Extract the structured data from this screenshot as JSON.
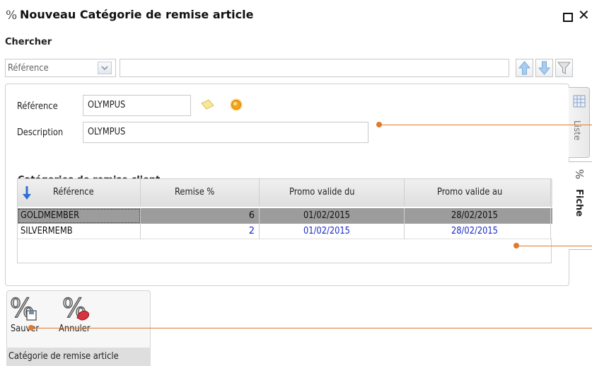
{
  "window": {
    "title_icon": "%",
    "title": "Nouveau Catégorie de remise article",
    "maximize_icon": "maximize-icon",
    "close_icon": "close-icon"
  },
  "search": {
    "label": "Chercher",
    "field_value": "Référence",
    "query": ""
  },
  "form": {
    "reference_label": "Référence",
    "reference_value": "OLYMPUS",
    "description_label": "Description",
    "description_value": "OLYMPUS"
  },
  "grid": {
    "title": "Catégories de remise client",
    "columns": [
      "Référence",
      "Remise %",
      "Promo valide du",
      "Promo valide au"
    ],
    "rows": [
      {
        "reference": "GOLDMEMBER",
        "remise": "6",
        "du": "01/02/2015",
        "au": "28/02/2015",
        "selected": true
      },
      {
        "reference": "SILVERMEMB",
        "remise": "2",
        "du": "01/02/2015",
        "au": "28/02/2015",
        "selected": false
      }
    ]
  },
  "tabs": {
    "liste": "Liste",
    "fiche": "Fiche"
  },
  "ribbon": {
    "save_label": "Sauver",
    "cancel_label": "Annuler",
    "group_caption": "Catégorie de remise article"
  },
  "colors": {
    "callout": "#e07a2c",
    "selected_row": "#9c9c9c",
    "link_text": "#1a2bc9"
  }
}
